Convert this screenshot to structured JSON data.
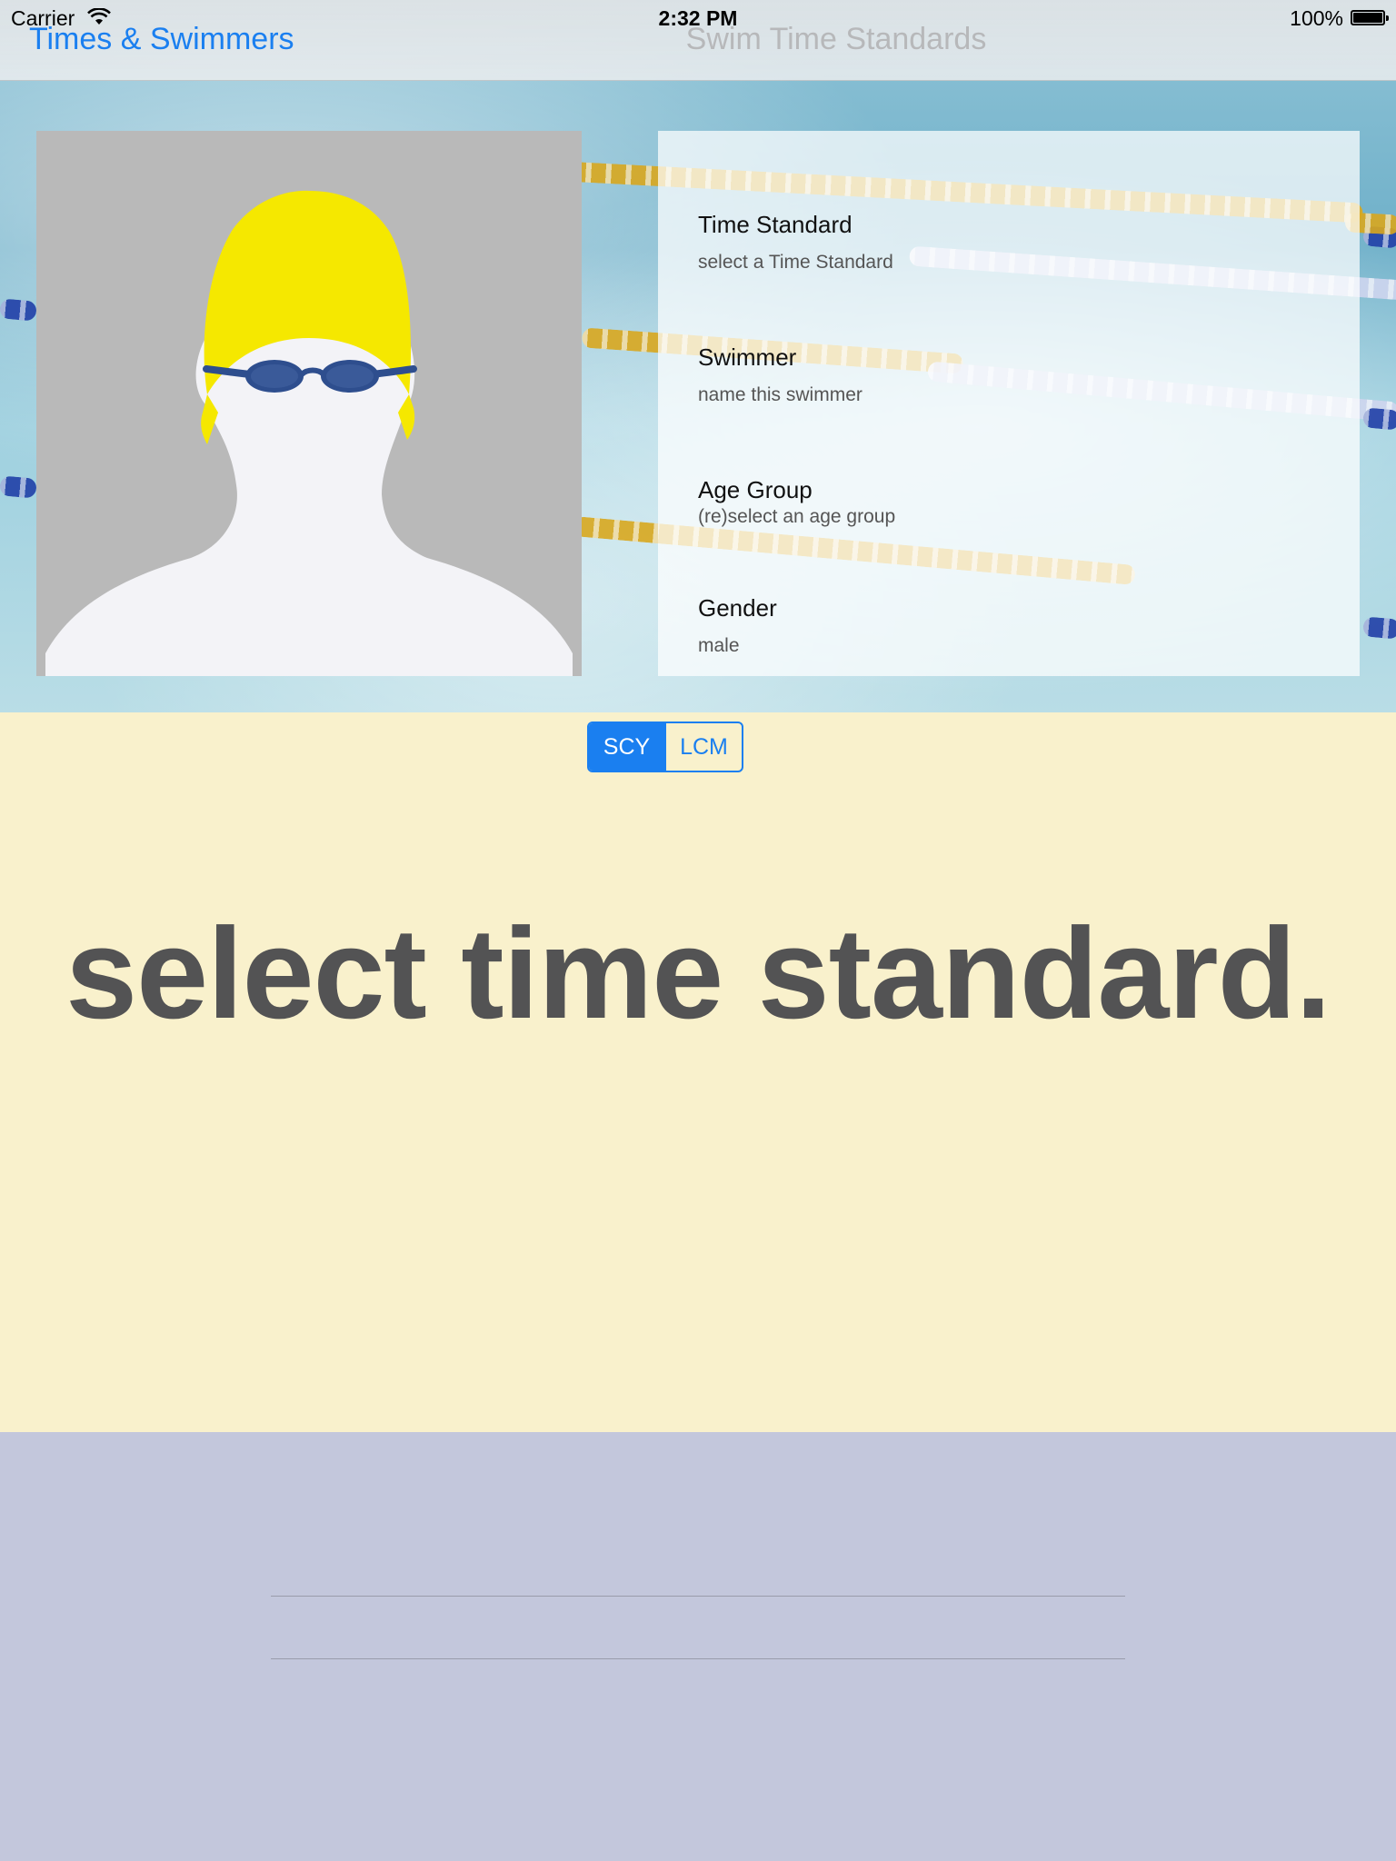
{
  "status_bar": {
    "carrier": "Carrier",
    "time": "2:32 PM",
    "battery": "100%"
  },
  "nav": {
    "back_label": "Times & Swimmers",
    "title": "Swim Time Standards"
  },
  "details": {
    "time_standard": {
      "label": "Time Standard",
      "value": "select a Time Standard"
    },
    "swimmer": {
      "label": "Swimmer",
      "value": "name this swimmer"
    },
    "age_group": {
      "label": "Age Group",
      "value": "(re)select an age group"
    },
    "gender": {
      "label": "Gender",
      "value": "male"
    }
  },
  "course_toggle": {
    "options": [
      "SCY",
      "LCM"
    ],
    "selected": "SCY"
  },
  "headline": "select time standard.",
  "colors": {
    "accent": "#1a7ff0",
    "main_background": "#f9f1cc",
    "bottom_background": "#c3c7dc",
    "headline_text": "#535354",
    "cap": "#f5e800",
    "goggles": "#2e4e8e"
  },
  "icons": {
    "avatar": "swimmer-avatar-icon",
    "wifi": "wifi-icon",
    "battery": "battery-icon"
  }
}
